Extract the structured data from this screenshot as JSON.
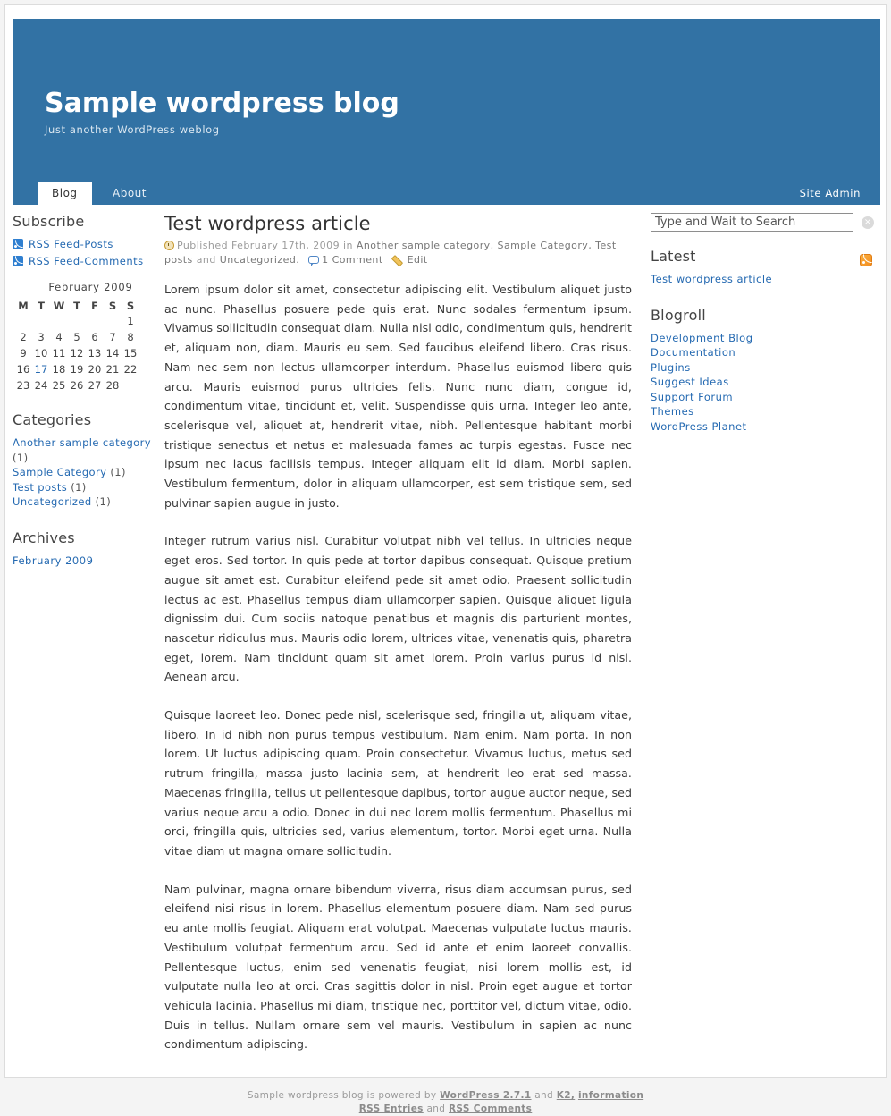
{
  "header": {
    "title": "Sample wordpress blog",
    "tagline": "Just another WordPress weblog",
    "nav": [
      {
        "label": "Blog",
        "active": true
      },
      {
        "label": "About",
        "active": false
      }
    ],
    "site_admin": "Site Admin",
    "bg_color": "#3272a4"
  },
  "left_sidebar": {
    "subscribe": {
      "title": "Subscribe",
      "feeds": [
        {
          "label": "RSS Feed-Posts",
          "icon": "rss-icon"
        },
        {
          "label": "RSS Feed-Comments",
          "icon": "rss-icon"
        }
      ]
    },
    "calendar": {
      "caption": "February 2009",
      "weekdays": [
        "M",
        "T",
        "W",
        "T",
        "F",
        "S",
        "S"
      ],
      "weeks": [
        [
          "",
          "",
          "",
          "",
          "",
          "",
          "1"
        ],
        [
          "2",
          "3",
          "4",
          "5",
          "6",
          "7",
          "8"
        ],
        [
          "9",
          "10",
          "11",
          "12",
          "13",
          "14",
          "15"
        ],
        [
          "16",
          "17",
          "18",
          "19",
          "20",
          "21",
          "22"
        ],
        [
          "23",
          "24",
          "25",
          "26",
          "27",
          "28",
          ""
        ]
      ],
      "linked_day": "17"
    },
    "categories": {
      "title": "Categories",
      "items": [
        {
          "label": "Another sample category",
          "count": "(1)"
        },
        {
          "label": "Sample Category",
          "count": "(1)"
        },
        {
          "label": "Test posts",
          "count": "(1)"
        },
        {
          "label": "Uncategorized",
          "count": "(1)"
        }
      ]
    },
    "archives": {
      "title": "Archives",
      "items": [
        {
          "label": "February 2009"
        }
      ]
    }
  },
  "post": {
    "title": "Test wordpress article",
    "meta": {
      "published_prefix": "Published",
      "date": "February 17th, 2009",
      "in_word": "in",
      "categories": "Another sample category, Sample Category, Test posts",
      "and_word": "and",
      "last_category": "Uncategorized.",
      "comments": "1 Comment",
      "edit": "Edit"
    },
    "paragraphs": [
      "Lorem ipsum dolor sit amet, consectetur adipiscing elit. Vestibulum aliquet justo ac nunc. Phasellus posuere pede quis erat. Nunc sodales fermentum ipsum. Vivamus sollicitudin consequat diam. Nulla nisl odio, condimentum quis, hendrerit et, aliquam non, diam. Mauris eu sem. Sed faucibus eleifend libero. Cras risus. Nam nec sem non lectus ullamcorper interdum. Phasellus euismod libero quis arcu. Mauris euismod purus ultricies felis. Nunc nunc diam, congue id, condimentum vitae, tincidunt et, velit. Suspendisse quis urna. Integer leo ante, scelerisque vel, aliquet at, hendrerit vitae, nibh. Pellentesque habitant morbi tristique senectus et netus et malesuada fames ac turpis egestas. Fusce nec ipsum nec lacus facilisis tempus. Integer aliquam elit id diam. Morbi sapien. Vestibulum fermentum, dolor in aliquam ullamcorper, est sem tristique sem, sed pulvinar sapien augue in justo.",
      "Integer rutrum varius nisl. Curabitur volutpat nibh vel tellus. In ultricies neque eget eros. Sed tortor. In quis pede at tortor dapibus consequat. Quisque pretium augue sit amet est. Curabitur eleifend pede sit amet odio. Praesent sollicitudin lectus ac est. Phasellus tempus diam ullamcorper sapien. Quisque aliquet ligula dignissim dui. Cum sociis natoque penatibus et magnis dis parturient montes, nascetur ridiculus mus. Mauris odio lorem, ultrices vitae, venenatis quis, pharetra eget, lorem. Nam tincidunt quam sit amet lorem. Proin varius purus id nisl. Aenean arcu.",
      "Quisque laoreet leo. Donec pede nisl, scelerisque sed, fringilla ut, aliquam vitae, libero. In id nibh non purus tempus vestibulum. Nam enim. Nam porta. In non lorem. Ut luctus adipiscing quam. Proin consectetur. Vivamus luctus, metus sed rutrum fringilla, massa justo lacinia sem, at hendrerit leo erat sed massa. Maecenas fringilla, tellus ut pellentesque dapibus, tortor augue auctor neque, sed varius neque arcu a odio. Donec in dui nec lorem mollis fermentum. Phasellus mi orci, fringilla quis, ultricies sed, varius elementum, tortor. Morbi eget urna. Nulla vitae diam ut magna ornare sollicitudin.",
      "Nam pulvinar, magna ornare bibendum viverra, risus diam accumsan purus, sed eleifend nisi risus in lorem. Phasellus elementum posuere diam. Nam sed purus eu ante mollis feugiat. Aliquam erat volutpat. Maecenas vulputate luctus mauris. Vestibulum volutpat fermentum arcu. Sed id ante et enim laoreet convallis. Pellentesque luctus, enim sed venenatis feugiat, nisi lorem mollis est, id vulputate nulla leo at orci. Cras sagittis dolor in nisl. Proin eget augue et tortor vehicula lacinia. Phasellus mi diam, tristique nec, porttitor vel, dictum vitae, odio. Duis in tellus. Nullam ornare sem vel mauris. Vestibulum in sapien ac nunc condimentum adipiscing."
    ]
  },
  "right_sidebar": {
    "search": {
      "placeholder": "Type and Wait to Search",
      "value": "",
      "clear_glyph": "×"
    },
    "latest": {
      "title": "Latest",
      "feed_icon": "rss-icon",
      "items": [
        {
          "label": "Test wordpress article"
        }
      ]
    },
    "blogroll": {
      "title": "Blogroll",
      "items": [
        {
          "label": "Development Blog"
        },
        {
          "label": "Documentation"
        },
        {
          "label": "Plugins"
        },
        {
          "label": "Suggest Ideas"
        },
        {
          "label": "Support Forum"
        },
        {
          "label": "Themes"
        },
        {
          "label": "WordPress Planet"
        }
      ]
    }
  },
  "footer": {
    "line1_prefix": "Sample wordpress blog is powered by",
    "wordpress": "WordPress 2.7.1",
    "and1": "and",
    "k2": "K2,",
    "information": "information",
    "rss_entries": "RSS Entries",
    "and2": "and",
    "rss_comments": "RSS Comments"
  },
  "colors": {
    "header_blue": "#3272a4",
    "link_blue": "#2469b1",
    "rss_orange": "#f28d20"
  }
}
